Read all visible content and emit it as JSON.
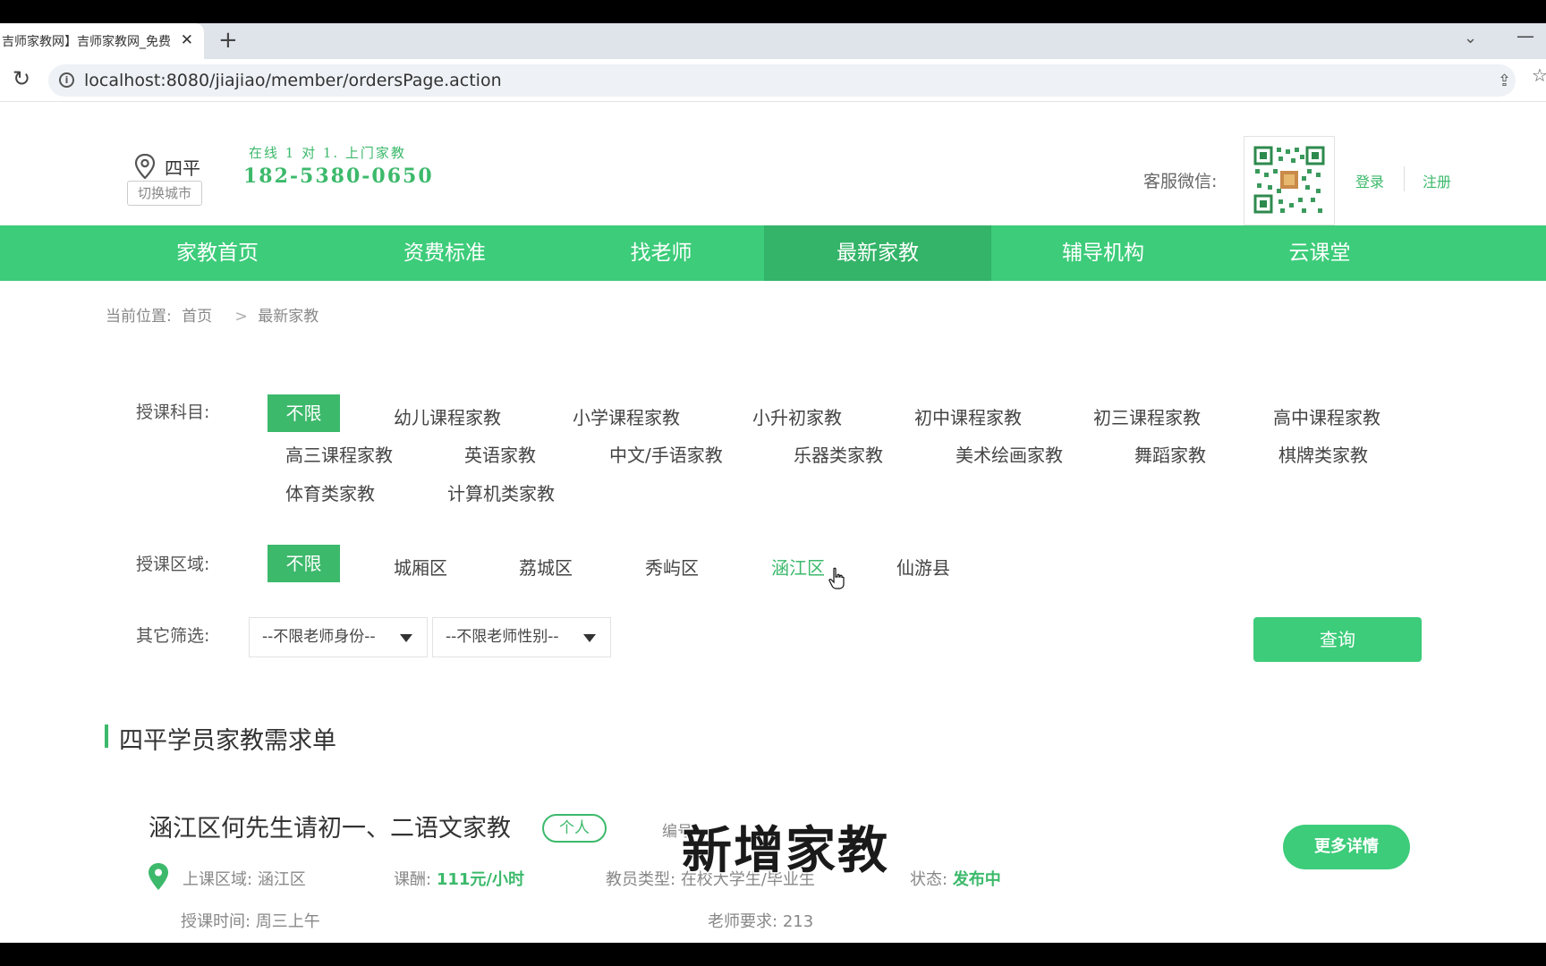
{
  "browser": {
    "tab_title": "吉师家教网】吉师家教网_免费",
    "tab_close": "✕",
    "new_tab": "+",
    "url": "localhost:8080/jiajiao/member/ordersPage.action"
  },
  "header": {
    "city": "四平",
    "switch_city": "切换城市",
    "slogan": "在线 1 对 1. 上门家教",
    "phone": "182-5380-0650",
    "wechat_label": "客服微信:",
    "login": "登录",
    "register": "注册"
  },
  "nav": {
    "items": [
      "家教首页",
      "资费标准",
      "找老师",
      "最新家教",
      "辅导机构",
      "云课堂"
    ],
    "active": "最新家教"
  },
  "breadcrumb": {
    "prefix": "当前位置:",
    "home": "首页",
    "separator": ">",
    "current": "最新家教"
  },
  "filters": {
    "subject_label": "授课科目:",
    "subjects": [
      "不限",
      "幼儿课程家教",
      "小学课程家教",
      "小升初家教",
      "初中课程家教",
      "初三课程家教",
      "高中课程家教",
      "高三课程家教",
      "英语家教",
      "中文/手语家教",
      "乐器类家教",
      "美术绘画家教",
      "舞蹈家教",
      "棋牌类家教",
      "体育类家教",
      "计算机类家教"
    ],
    "subject_selected": "不限",
    "area_label": "授课区域:",
    "areas": [
      "不限",
      "城厢区",
      "荔城区",
      "秀屿区",
      "涵江区",
      "仙游县"
    ],
    "area_selected": "不限",
    "area_hover": "涵江区",
    "other_label": "其它筛选:",
    "identity_select": "--不限老师身份--",
    "gender_select": "--不限老师性别--",
    "query_button": "查询"
  },
  "section": {
    "title": "四平学员家教需求单"
  },
  "orders": [
    {
      "title": "涵江区何先生请初一、二语文家教",
      "badge": "个人",
      "code_label": "编号",
      "area_label": "上课区域:",
      "area": "涵江区",
      "fee_label": "课酬:",
      "fee": "111元/小时",
      "teacher_type_label": "教员类型:",
      "teacher_type": "在校大学生/毕业生",
      "status_label": "状态:",
      "status": "发布中",
      "time_label": "授课时间:",
      "time": "周三上午",
      "requirement_label": "老师要求:",
      "requirement": "213",
      "details_button": "更多详情"
    }
  ],
  "overlay": {
    "subtitle": "新增家教"
  },
  "colors": {
    "brand_green": "#3dcc7a",
    "text_green": "#3cb96b",
    "nav_active": "#33b468"
  },
  "icons": {
    "location": "location-pin-icon",
    "reload": "reload-icon",
    "info": "info-icon",
    "share": "share-icon",
    "star": "star-icon",
    "caret": "caret-down-icon"
  }
}
